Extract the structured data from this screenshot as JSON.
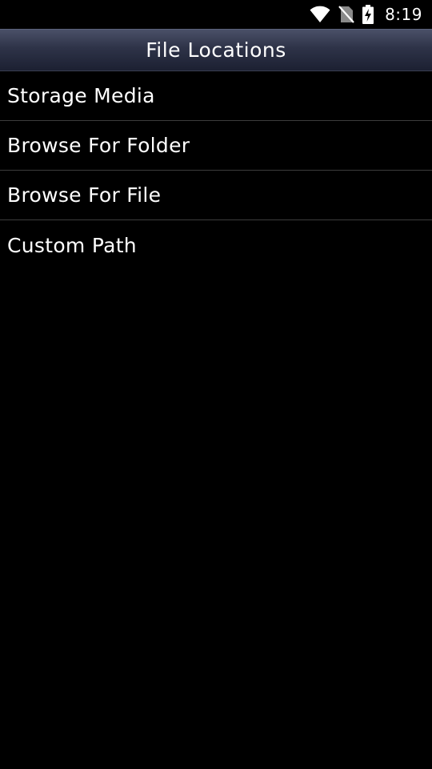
{
  "status_bar": {
    "time": "8:19",
    "icons": [
      "wifi-icon",
      "no-sim-icon",
      "battery-charging-icon"
    ]
  },
  "header": {
    "title": "File Locations"
  },
  "list": {
    "items": [
      {
        "label": "Storage Media"
      },
      {
        "label": "Browse For Folder"
      },
      {
        "label": "Browse For File"
      },
      {
        "label": "Custom Path"
      }
    ]
  },
  "colors": {
    "background": "#000000",
    "header_top": "#4a5068",
    "header_bottom": "#1c2032",
    "divider": "#3c3c3c",
    "text": "#ffffff"
  }
}
